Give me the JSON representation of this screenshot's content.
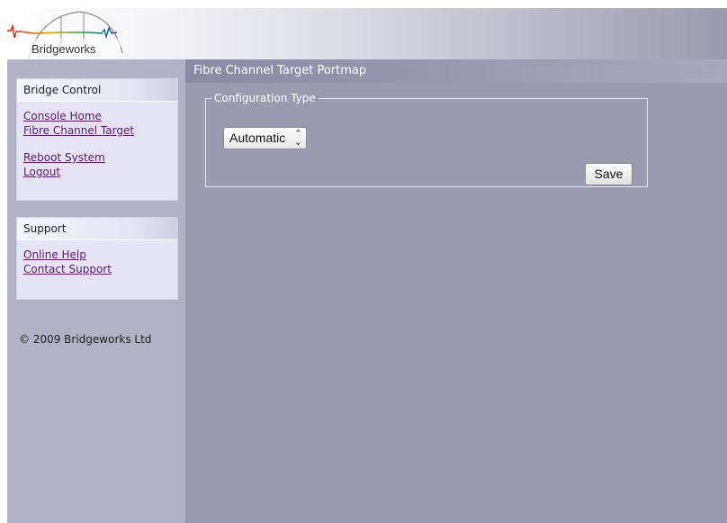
{
  "header": {
    "logo_text": "Bridgeworks"
  },
  "sidebar": {
    "bridge_control": {
      "title": "Bridge Control",
      "links": [
        "Console Home",
        "Fibre Channel Target",
        "Reboot System",
        "Logout"
      ]
    },
    "support": {
      "title": "Support",
      "links": [
        "Online Help",
        "Contact Support"
      ]
    },
    "copyright": "© 2009 Bridgeworks Ltd"
  },
  "main": {
    "page_title": "Fibre Channel Target Portmap",
    "config": {
      "legend": "Configuration Type",
      "select_value": "Automatic",
      "save_label": "Save"
    }
  },
  "colors": {
    "sidebar_bg": "#b2b2c6",
    "main_bg": "#9a9ab0",
    "panel_bg": "#e4e4f4",
    "link": "#5a1a6e"
  }
}
